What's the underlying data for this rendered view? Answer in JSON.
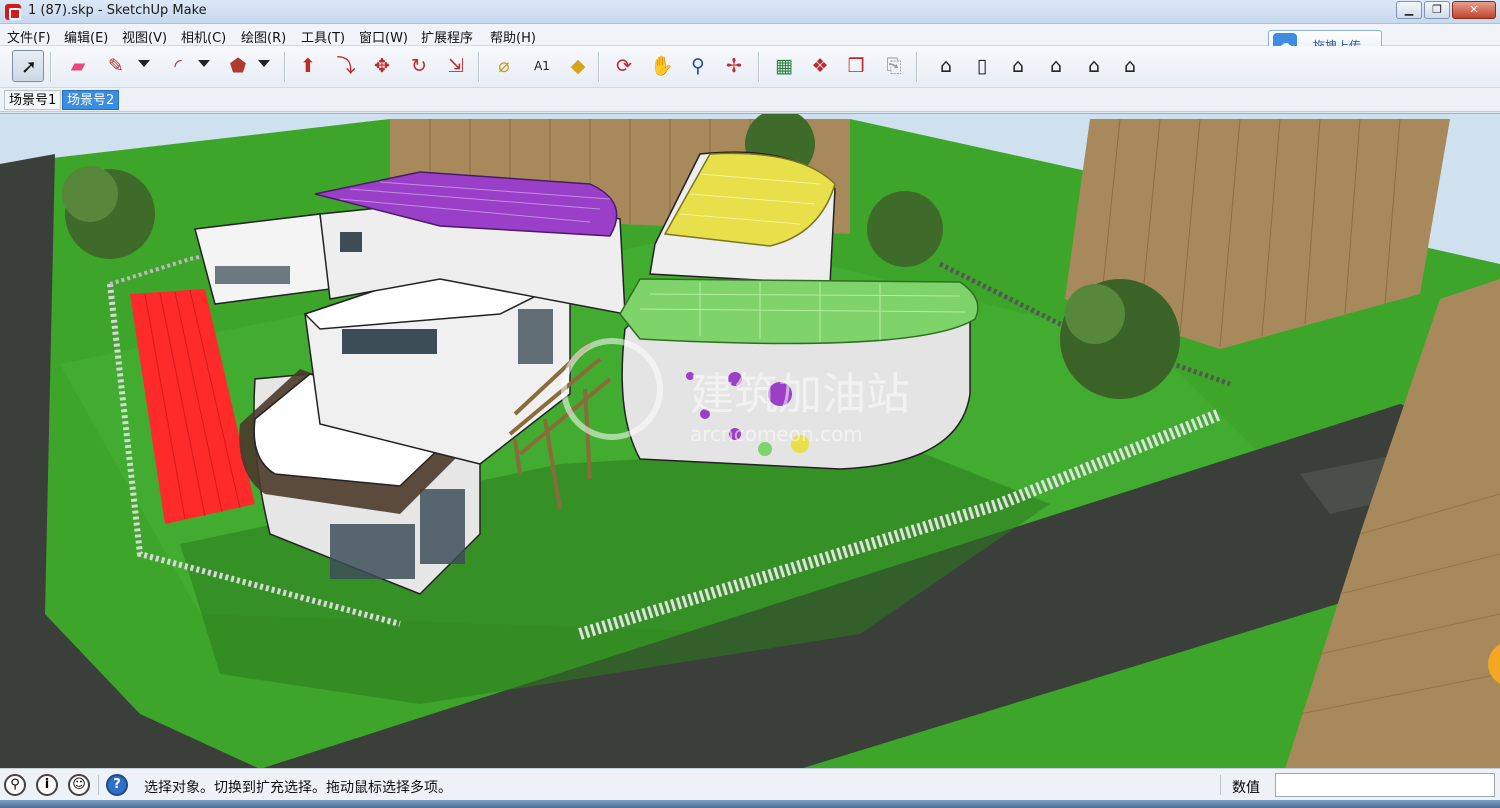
{
  "window": {
    "title": "1 (87).skp - SketchUp Make",
    "minimize": "▁",
    "restore": "❐",
    "close": "✕"
  },
  "menu": [
    "文件(F)",
    "编辑(E)",
    "视图(V)",
    "相机(C)",
    "绘图(R)",
    "工具(T)",
    "窗口(W)",
    "扩展程序",
    "帮助(H)"
  ],
  "upload": {
    "label": "拖拽上传",
    "icon": "cloud-upload-icon"
  },
  "toolbar": {
    "tools": [
      {
        "name": "select-tool",
        "icon": "arrow-cursor-icon",
        "glyph": "➚",
        "color": "#111111"
      },
      {
        "name": "eraser-tool",
        "icon": "eraser-icon",
        "glyph": "▰",
        "color": "#e64a7a"
      },
      {
        "name": "line-tool",
        "icon": "pencil-icon",
        "glyph": "✎",
        "color": "#c0282d"
      },
      {
        "name": "arc-tool",
        "icon": "arc-icon",
        "glyph": "◜",
        "color": "#c0282d"
      },
      {
        "name": "shape-tool",
        "icon": "polygon-icon",
        "glyph": "⬟",
        "color": "#b03a2e"
      },
      {
        "name": "push-pull-tool",
        "icon": "push-pull-icon",
        "glyph": "⬆",
        "color": "#c0282d"
      },
      {
        "name": "follow-me-tool",
        "icon": "follow-me-icon",
        "glyph": "⤵",
        "color": "#c0282d"
      },
      {
        "name": "move-tool",
        "icon": "move-icon",
        "glyph": "✥",
        "color": "#c0282d"
      },
      {
        "name": "rotate-tool",
        "icon": "rotate-icon",
        "glyph": "↻",
        "color": "#c0282d"
      },
      {
        "name": "scale-tool",
        "icon": "scale-icon",
        "glyph": "⇲",
        "color": "#c0282d"
      },
      {
        "name": "tape-measure-tool",
        "icon": "tape-measure-icon",
        "glyph": "⌀",
        "color": "#c89b1b"
      },
      {
        "name": "text-tool",
        "icon": "text-label-icon",
        "glyph": "A1",
        "color": "#222222"
      },
      {
        "name": "paint-bucket-tool",
        "icon": "paint-bucket-icon",
        "glyph": "◆",
        "color": "#d9a21b"
      },
      {
        "name": "orbit-tool",
        "icon": "orbit-icon",
        "glyph": "⟳",
        "color": "#c0282d"
      },
      {
        "name": "pan-tool",
        "icon": "hand-icon",
        "glyph": "✋",
        "color": "#333333"
      },
      {
        "name": "zoom-tool",
        "icon": "magnifier-icon",
        "glyph": "⚲",
        "color": "#1d4fa0"
      },
      {
        "name": "zoom-extents-tool",
        "icon": "zoom-extents-icon",
        "glyph": "✢",
        "color": "#c0282d"
      },
      {
        "name": "geo-location-tool",
        "icon": "map-icon",
        "glyph": "▦",
        "color": "#2a7f3a"
      },
      {
        "name": "3d-warehouse-tool",
        "icon": "warehouse-icon",
        "glyph": "❖",
        "color": "#c0282d"
      },
      {
        "name": "share-model-tool",
        "icon": "share-model-icon",
        "glyph": "❒",
        "color": "#c0282d"
      },
      {
        "name": "extension-warehouse-tool",
        "icon": "extension-icon",
        "glyph": "⎘",
        "color": "#999999"
      },
      {
        "name": "iso-view",
        "icon": "iso-house-icon",
        "glyph": "⌂",
        "color": "#222222"
      },
      {
        "name": "top-view",
        "icon": "top-view-icon",
        "glyph": "▯",
        "color": "#222222"
      },
      {
        "name": "front-view",
        "icon": "front-house-icon",
        "glyph": "⌂",
        "color": "#222222"
      },
      {
        "name": "right-view",
        "icon": "right-house-icon",
        "glyph": "⌂",
        "color": "#222222"
      },
      {
        "name": "back-view",
        "icon": "back-house-icon",
        "glyph": "⌂",
        "color": "#222222"
      },
      {
        "name": "left-view",
        "icon": "left-house-icon",
        "glyph": "⌂",
        "color": "#222222"
      }
    ]
  },
  "scenes": [
    {
      "label": "场景号1",
      "active": false
    },
    {
      "label": "场景号2",
      "active": true
    }
  ],
  "watermark": {
    "title": "建筑加油站",
    "subtitle": "arcncomeon.com"
  },
  "status": {
    "icons": [
      "geo-pin-icon",
      "info-icon",
      "user-icon",
      "help-icon"
    ],
    "message": "选择对象。切换到扩充选择。拖动鼠标选择多项。",
    "measure_label": "数值",
    "measure_value": ""
  },
  "colors": {
    "grass": "#3ea52b",
    "grass_dark": "#2b7a1d",
    "road": "#3a3f3a",
    "roof_purple": "#9a3fc7",
    "roof_yellow": "#e7e04a",
    "roof_green": "#7ed36a",
    "track_red": "#ff2a2a",
    "tower": "#a8895c"
  }
}
